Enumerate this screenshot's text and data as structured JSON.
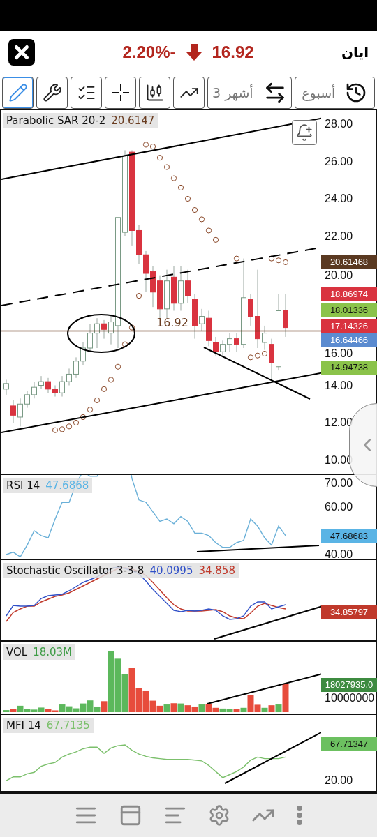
{
  "header": {
    "symbol": "ايان",
    "change": "2.20%-",
    "falling": true,
    "price": "16.92"
  },
  "toolbar": {
    "tools": [
      {
        "kind": "pencil",
        "selected": true
      },
      {
        "kind": "tools",
        "selected": false
      },
      {
        "kind": "checklist",
        "selected": false
      },
      {
        "kind": "crosshair",
        "selected": false
      },
      {
        "kind": "candles",
        "selected": false
      },
      {
        "kind": "trend",
        "selected": false
      }
    ],
    "range": "3 أشهر",
    "interval": "أسبوع"
  },
  "main_panel": {
    "legend_name": "Parabolic SAR 20-2",
    "legend_value": "20.6147",
    "price_line_label": "16.92",
    "axis_ticks": [
      "28.00",
      "26.00",
      "24.00",
      "22.00",
      "20.00",
      "16.00",
      "14.00",
      "12.00",
      "10.00"
    ],
    "price_tags": [
      {
        "text": "20.61468",
        "color": "#5a3921"
      },
      {
        "text": "18.86974",
        "color": "#d9333f"
      },
      {
        "text": "18.01336",
        "color": "#8bc34a"
      },
      {
        "text": "17.14326",
        "color": "#d9333f"
      },
      {
        "text": "16.64466",
        "color": "#5b8bd0"
      },
      {
        "text": "14.94738",
        "color": "#8bc34a"
      }
    ]
  },
  "rsi_panel": {
    "legend_name": "RSI 14",
    "legend_value": "47.6868",
    "axis_ticks": [
      "70.00",
      "60.00",
      "40.00"
    ],
    "tags": [
      {
        "text": "47.68683",
        "color": "#5ab4e5"
      }
    ]
  },
  "stochastic_panel": {
    "legend_name": "Stochastic Oscillator 3-3-8",
    "values": [
      {
        "text": "40.0995",
        "color": "#3050c8"
      },
      {
        "text": "34.858",
        "color": "#c0392b"
      }
    ],
    "tags": [
      {
        "text": "34.85797",
        "color": "#c0392b"
      }
    ]
  },
  "volume_panel": {
    "legend_name": "VOL",
    "legend_value": "18.03M",
    "axis_ticks": [
      "10000000"
    ],
    "tags": [
      {
        "text": "18027935.0",
        "color": "#3d8b40"
      }
    ]
  },
  "mfi_panel": {
    "legend_name": "MFI 14",
    "legend_value": "67.7135",
    "axis_ticks": [
      "20.00"
    ],
    "tags": [
      {
        "text": "67.71347",
        "color": "#6cc060"
      }
    ]
  }
}
